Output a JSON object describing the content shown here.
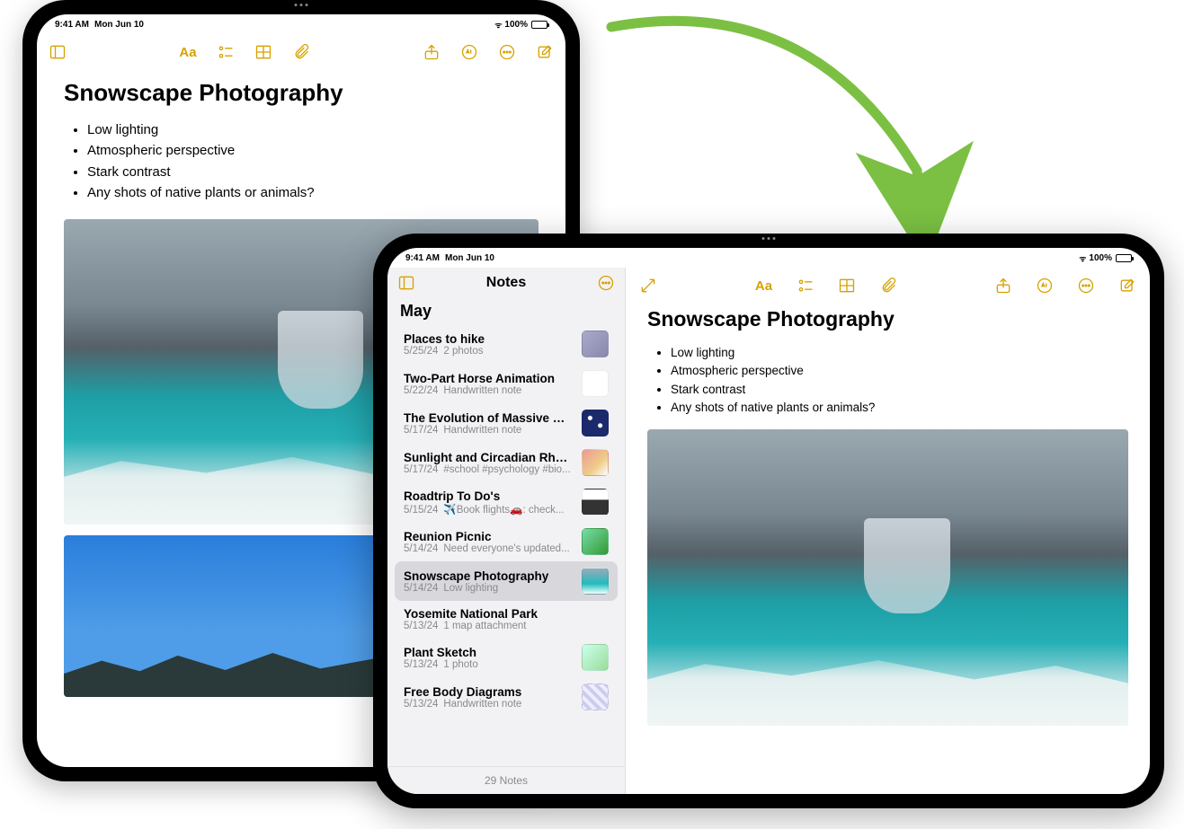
{
  "status": {
    "time": "9:41 AM",
    "date": "Mon Jun 10",
    "battery": "100%"
  },
  "note": {
    "title": "Snowscape Photography",
    "bullets": [
      "Low lighting",
      "Atmospheric perspective",
      "Stark contrast",
      "Any shots of native plants or animals?"
    ]
  },
  "sidebar": {
    "title": "Notes",
    "section": "May",
    "footer": "29 Notes",
    "items": [
      {
        "title": "Places to hike",
        "date": "5/25/24",
        "preview": "2 photos"
      },
      {
        "title": "Two-Part Horse Animation",
        "date": "5/22/24",
        "preview": "Handwritten note"
      },
      {
        "title": "The Evolution of Massive Star...",
        "date": "5/17/24",
        "preview": "Handwritten note"
      },
      {
        "title": "Sunlight and Circadian Rhyth...",
        "date": "5/17/24",
        "preview": "#school #psychology #bio..."
      },
      {
        "title": "Roadtrip To Do's",
        "date": "5/15/24",
        "preview": "✈️Book flights🚗: check..."
      },
      {
        "title": "Reunion Picnic",
        "date": "5/14/24",
        "preview": "Need everyone's updated..."
      },
      {
        "title": "Snowscape Photography",
        "date": "5/14/24",
        "preview": "Low lighting"
      },
      {
        "title": "Yosemite National Park",
        "date": "5/13/24",
        "preview": "1 map attachment"
      },
      {
        "title": "Plant Sketch",
        "date": "5/13/24",
        "preview": "1 photo"
      },
      {
        "title": "Free Body Diagrams",
        "date": "5/13/24",
        "preview": "Handwritten note"
      }
    ]
  },
  "toolbar": {
    "format": "Aa"
  }
}
